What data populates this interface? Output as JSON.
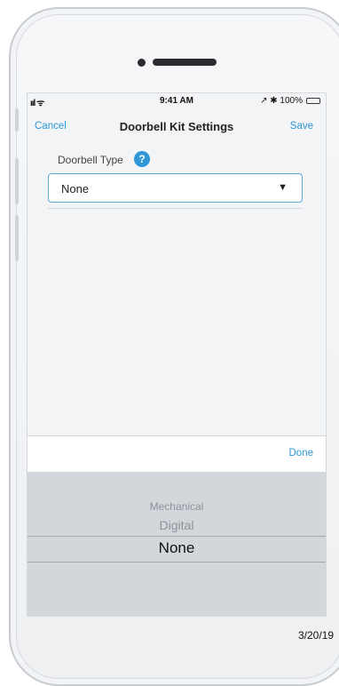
{
  "status_bar": {
    "signal_wifi": "ııl ᯤ",
    "time": "9:41 AM",
    "right_text": "↗ ✱ 100%"
  },
  "nav": {
    "left": "Cancel",
    "title": "Doorbell Kit Settings",
    "right": "Save"
  },
  "form": {
    "label": "Doorbell Type",
    "help_icon": "?",
    "selected_value": "None",
    "arrow": "▼"
  },
  "toolbar": {
    "done": "Done"
  },
  "picker": {
    "options": [
      "Mechanical",
      "Digital",
      "None"
    ],
    "selected": "None"
  },
  "footer": {
    "timestamp": "3/20/19"
  },
  "colors": {
    "accent": "#2f97d8",
    "battery": "#2bd14a",
    "picker_bg": "#d3d6db"
  }
}
